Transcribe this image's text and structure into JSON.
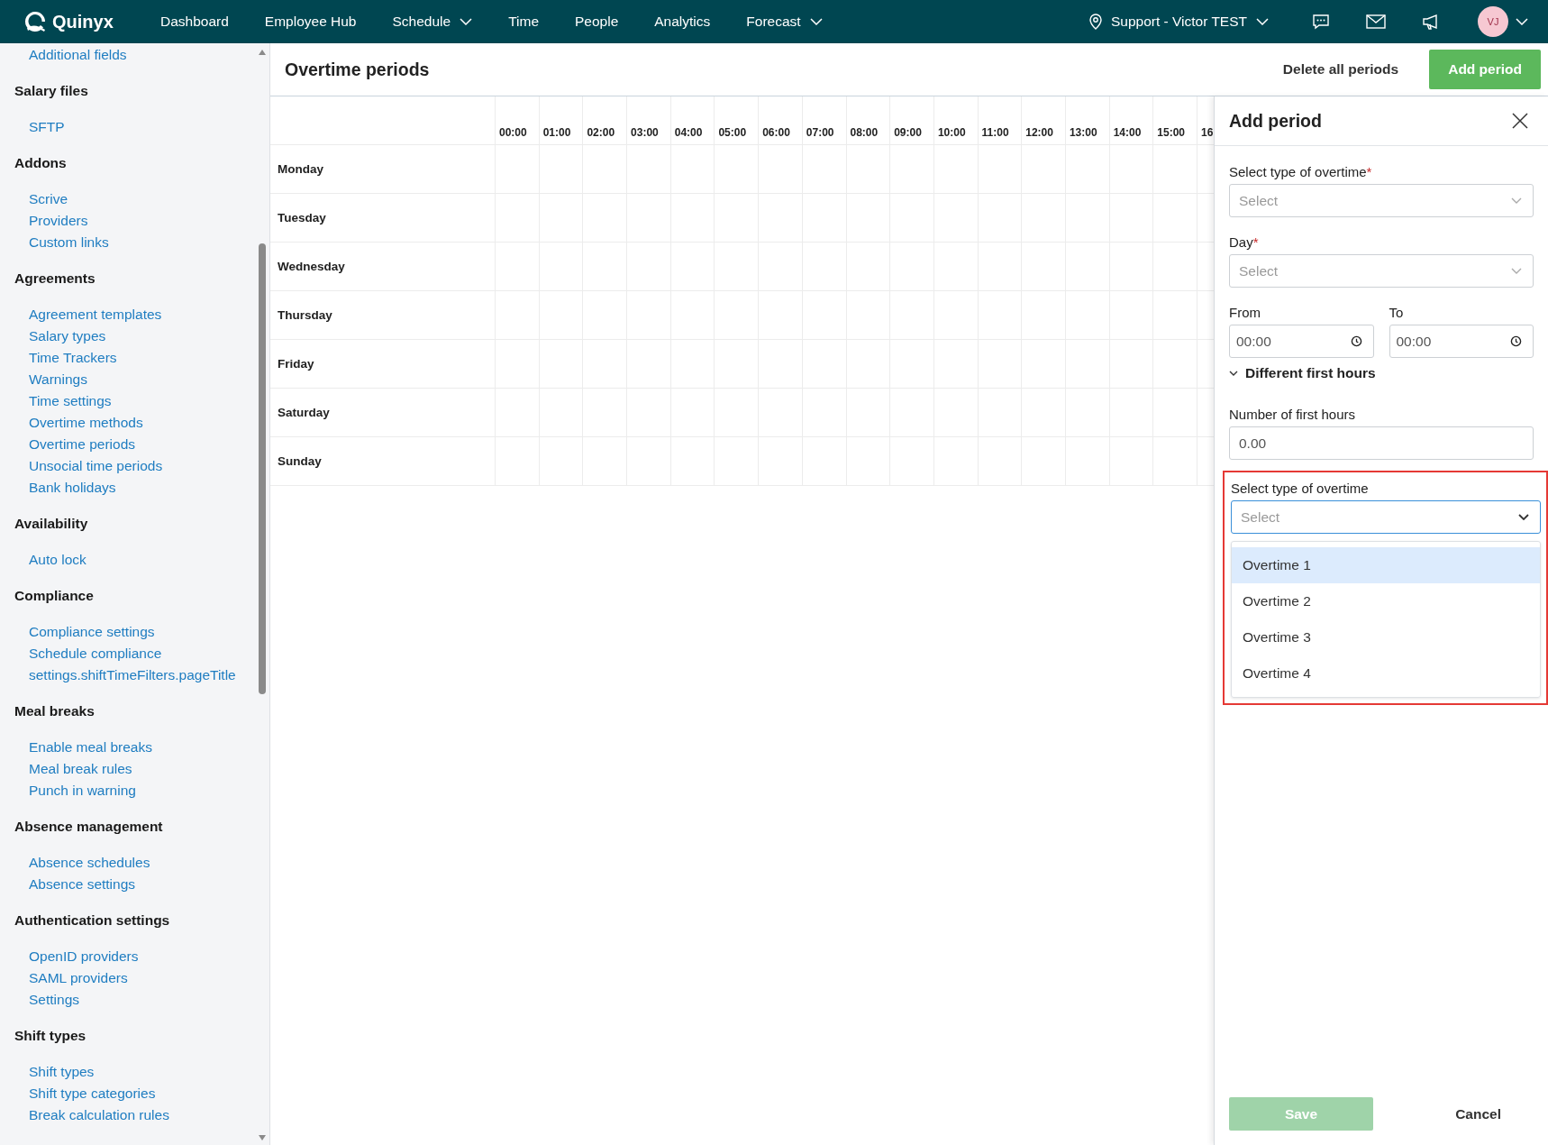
{
  "nav": {
    "logo": "Quinyx",
    "items": [
      {
        "label": "Dashboard",
        "has_menu": false
      },
      {
        "label": "Employee Hub",
        "has_menu": false
      },
      {
        "label": "Schedule",
        "has_menu": true
      },
      {
        "label": "Time",
        "has_menu": false
      },
      {
        "label": "People",
        "has_menu": false
      },
      {
        "label": "Analytics",
        "has_menu": false
      },
      {
        "label": "Forecast",
        "has_menu": true
      }
    ],
    "location": "Support - Victor TEST",
    "avatar": "VJ"
  },
  "sidebar": {
    "sections": [
      {
        "items": [
          "Additional fields"
        ]
      },
      {
        "title": "Salary files",
        "items": [
          "SFTP"
        ]
      },
      {
        "title": "Addons",
        "items": [
          "Scrive",
          "Providers",
          "Custom links"
        ]
      },
      {
        "title": "Agreements",
        "items": [
          "Agreement templates",
          "Salary types",
          "Time Trackers",
          "Warnings",
          "Time settings",
          "Overtime methods",
          "Overtime periods",
          "Unsocial time periods",
          "Bank holidays"
        ]
      },
      {
        "title": "Availability",
        "items": [
          "Auto lock"
        ]
      },
      {
        "title": "Compliance",
        "items": [
          "Compliance settings",
          "Schedule compliance",
          "settings.shiftTimeFilters.pageTitle"
        ]
      },
      {
        "title": "Meal breaks",
        "items": [
          "Enable meal breaks",
          "Meal break rules",
          "Punch in warning"
        ]
      },
      {
        "title": "Absence management",
        "items": [
          "Absence schedules",
          "Absence settings"
        ]
      },
      {
        "title": "Authentication settings",
        "items": [
          "OpenID providers",
          "SAML providers",
          "Settings"
        ]
      },
      {
        "title": "Shift types",
        "items": [
          "Shift types",
          "Shift type categories",
          "Break calculation rules"
        ]
      }
    ]
  },
  "page": {
    "title": "Overtime periods",
    "actions": {
      "delete_all": "Delete all periods",
      "add": "Add period"
    }
  },
  "grid": {
    "hours": [
      "00:00",
      "01:00",
      "02:00",
      "03:00",
      "04:00",
      "05:00",
      "06:00",
      "07:00",
      "08:00",
      "09:00",
      "10:00",
      "11:00",
      "12:00",
      "13:00",
      "14:00",
      "15:00",
      "16"
    ],
    "days": [
      "Monday",
      "Tuesday",
      "Wednesday",
      "Thursday",
      "Friday",
      "Saturday",
      "Sunday"
    ]
  },
  "panel": {
    "title": "Add period",
    "type_select": {
      "label": "Select type of overtime",
      "required_mark": "*",
      "placeholder": "Select"
    },
    "day_select": {
      "label": "Day",
      "required_mark": "*",
      "placeholder": "Select"
    },
    "from": {
      "label": "From",
      "value": "00:00"
    },
    "to": {
      "label": "To",
      "value": "00:00"
    },
    "first_hours": {
      "label": "Different first hours",
      "expanded": true
    },
    "number_of_first_hours": {
      "label": "Number of first hours",
      "value": "0.00"
    },
    "first_hours_type": {
      "label": "Select type of overtime",
      "placeholder": "Select",
      "open": true,
      "highlighted": true,
      "options": [
        {
          "label": "Overtime 1",
          "selected": true
        },
        {
          "label": "Overtime 2",
          "selected": false
        },
        {
          "label": "Overtime 3",
          "selected": false
        },
        {
          "label": "Overtime 4",
          "selected": false
        }
      ]
    },
    "save": {
      "label": "Save",
      "disabled": true
    },
    "cancel": "Cancel"
  }
}
